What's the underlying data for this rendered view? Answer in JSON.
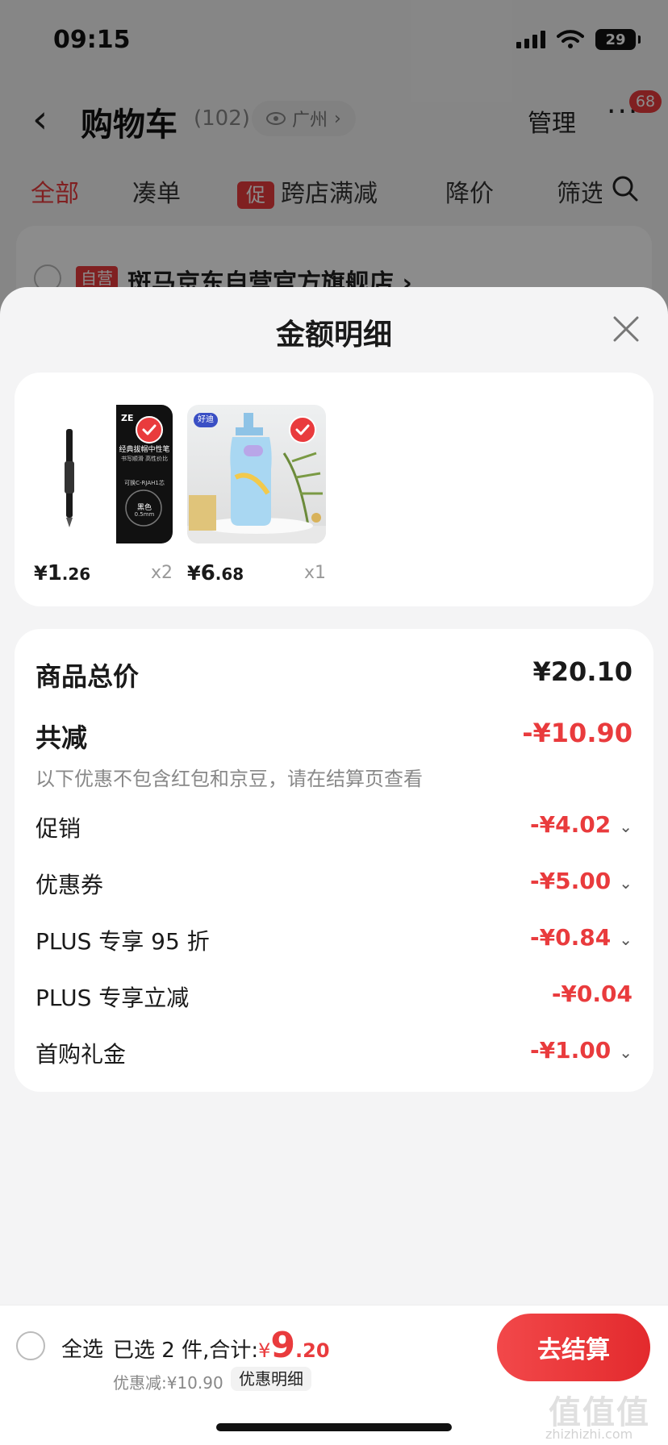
{
  "status_bar": {
    "time": "09:15",
    "battery": "29"
  },
  "nav": {
    "title": "购物车",
    "count": "(102)",
    "location": "广州",
    "manage": "管理",
    "more": "···",
    "badge": "68"
  },
  "filters": {
    "all": "全部",
    "bundle": "凑单",
    "promo_tag": "促",
    "cross_store": "跨店满减",
    "price_drop": "降价",
    "filter": "筛选"
  },
  "store": {
    "tag": "自营",
    "name": "斑马京东自营官方旗舰店 ›"
  },
  "sheet": {
    "title": "金额明细",
    "products": [
      {
        "price_currency": "¥",
        "price_int": "1",
        "price_dec": ".26",
        "qty": "x2",
        "img_text_1": "经典拔帽中性笔",
        "img_text_2": "书写顺滑 高性价比",
        "img_text_3": "可换C-RJAH1芯",
        "img_text_4": "黑色",
        "img_text_5": "0.5mm",
        "img_brand": "ZE"
      },
      {
        "price_currency": "¥",
        "price_int": "6",
        "price_dec": ".68",
        "qty": "x1",
        "img_brand": "好迪"
      }
    ],
    "rows": {
      "subtotal_label": "商品总价",
      "subtotal_value": "¥20.10",
      "total_discount_label": "共减",
      "total_discount_value": "-¥10.90",
      "note": "以下优惠不包含红包和京豆，请在结算页查看",
      "promo_label": "促销",
      "promo_value": "-¥4.02",
      "coupon_label": "优惠券",
      "coupon_value": "-¥5.00",
      "plus95_label": "PLUS 专享 95 折",
      "plus95_value": "-¥0.84",
      "plus_off_label": "PLUS 专享立减",
      "plus_off_value": "-¥0.04",
      "first_buy_label": "首购礼金",
      "first_buy_value": "-¥1.00"
    }
  },
  "checkout": {
    "select_all": "全选",
    "summary_prefix": "已选 2 件,合计:",
    "total_currency": "¥",
    "total_int": "9",
    "total_dec": ".20",
    "discount_line": "优惠减:¥10.90",
    "detail_link": "优惠明细",
    "button": "去结算",
    "watermark": "值值值",
    "watermark_sub": "zhizhizhi.com"
  },
  "colors": {
    "accent": "#e93b3d",
    "sheet_bg": "#f4f4f5"
  }
}
